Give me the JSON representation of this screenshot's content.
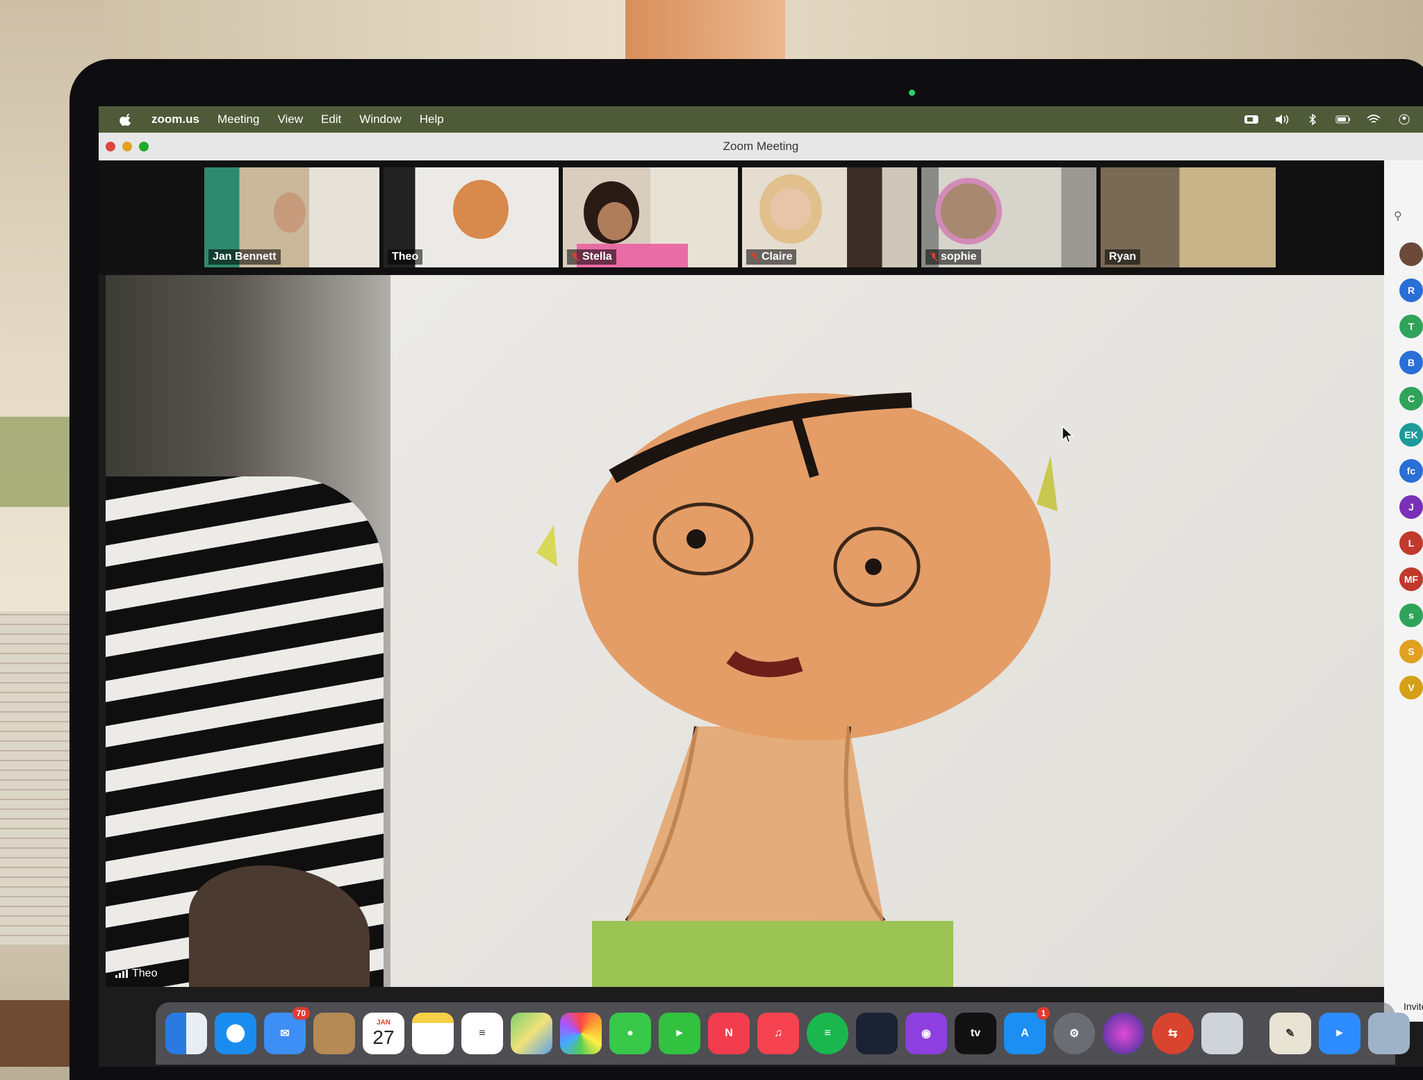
{
  "menubar": {
    "app_name": "zoom.us",
    "menus": [
      "Meeting",
      "View",
      "Edit",
      "Window",
      "Help"
    ]
  },
  "window": {
    "title": "Zoom Meeting"
  },
  "participants_strip": [
    {
      "name": "Jan Bennett",
      "muted": false,
      "active": false
    },
    {
      "name": "Theo",
      "muted": false,
      "active": true
    },
    {
      "name": "Stella",
      "muted": true,
      "active": false
    },
    {
      "name": "Claire",
      "muted": true,
      "active": false
    },
    {
      "name": "sophie",
      "muted": true,
      "active": false
    },
    {
      "name": "Ryan",
      "muted": false,
      "active": false
    }
  ],
  "main_video": {
    "speaker_name": "Theo"
  },
  "participants_panel": {
    "avatars": [
      {
        "initials": "",
        "color": "#6b4a3a"
      },
      {
        "initials": "R",
        "color": "#2a6fd6"
      },
      {
        "initials": "T",
        "color": "#2fa35a"
      },
      {
        "initials": "B",
        "color": "#2a6fd6"
      },
      {
        "initials": "C",
        "color": "#2fa35a"
      },
      {
        "initials": "EK",
        "color": "#1e9a9a"
      },
      {
        "initials": "fc",
        "color": "#2a6fd6"
      },
      {
        "initials": "J",
        "color": "#7a2fb8"
      },
      {
        "initials": "L",
        "color": "#c0392b"
      },
      {
        "initials": "MF",
        "color": "#c0392b"
      },
      {
        "initials": "s",
        "color": "#2fa35a"
      },
      {
        "initials": "S",
        "color": "#e0a020"
      },
      {
        "initials": "V",
        "color": "#d4a017"
      }
    ],
    "invite_label": "Invite"
  },
  "dock": {
    "mail_badge": "70",
    "calendar_month": "JAN",
    "calendar_day": "27",
    "appstore_badge": "1",
    "tv_label": "tv",
    "apps": [
      "finder",
      "safari",
      "mail",
      "contacts",
      "calendar",
      "notes",
      "reminders",
      "maps",
      "photos",
      "messages",
      "facetime",
      "news",
      "music",
      "spotify",
      "kindle",
      "podcasts",
      "tv",
      "app-store",
      "system-preferences",
      "siri",
      "teamviewer",
      "launchpad",
      "script-editor",
      "zoom",
      "preview"
    ]
  }
}
